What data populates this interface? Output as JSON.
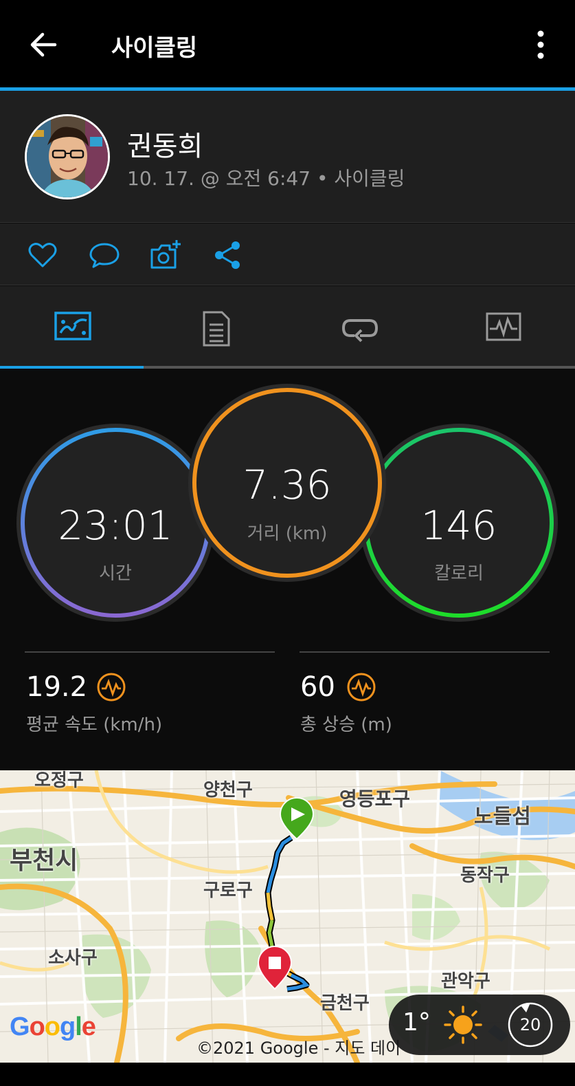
{
  "appbar": {
    "title": "사이클링",
    "back_icon": "arrow-left-icon",
    "more_icon": "more-vert-icon",
    "accent_color": "#1aa0e6"
  },
  "profile": {
    "name": "권동희",
    "meta": "10. 17. @ 오전 6:47 • 사이클링"
  },
  "actions": [
    {
      "icon": "heart-icon"
    },
    {
      "icon": "comment-icon"
    },
    {
      "icon": "add-photo-icon"
    },
    {
      "icon": "share-icon"
    }
  ],
  "tabs": [
    {
      "icon": "overview-tab-icon",
      "active": true
    },
    {
      "icon": "details-tab-icon"
    },
    {
      "icon": "laps-tab-icon"
    },
    {
      "icon": "charts-tab-icon"
    }
  ],
  "gauges": {
    "time": {
      "value": "23:01",
      "label": "시간"
    },
    "distance": {
      "value": "7.36",
      "label": "거리 (km)"
    },
    "calories": {
      "value": "146",
      "label": "칼로리"
    }
  },
  "metrics": {
    "avg_speed": {
      "value": "19.2",
      "label": "평균 속도 (km/h)"
    },
    "total_ascent": {
      "value": "60",
      "label": "총 상승 (m)"
    }
  },
  "map": {
    "labels": [
      "양천구",
      "영등포구",
      "노들섬",
      "부천시",
      "구로구",
      "동작구",
      "소사구",
      "관악구",
      "금천구",
      "오정구"
    ],
    "copyright": "©2021 Google - 지도 데이",
    "google_logo": "Google",
    "weather": {
      "temp": "1°",
      "wind": "20",
      "icon": "sun-icon"
    }
  }
}
